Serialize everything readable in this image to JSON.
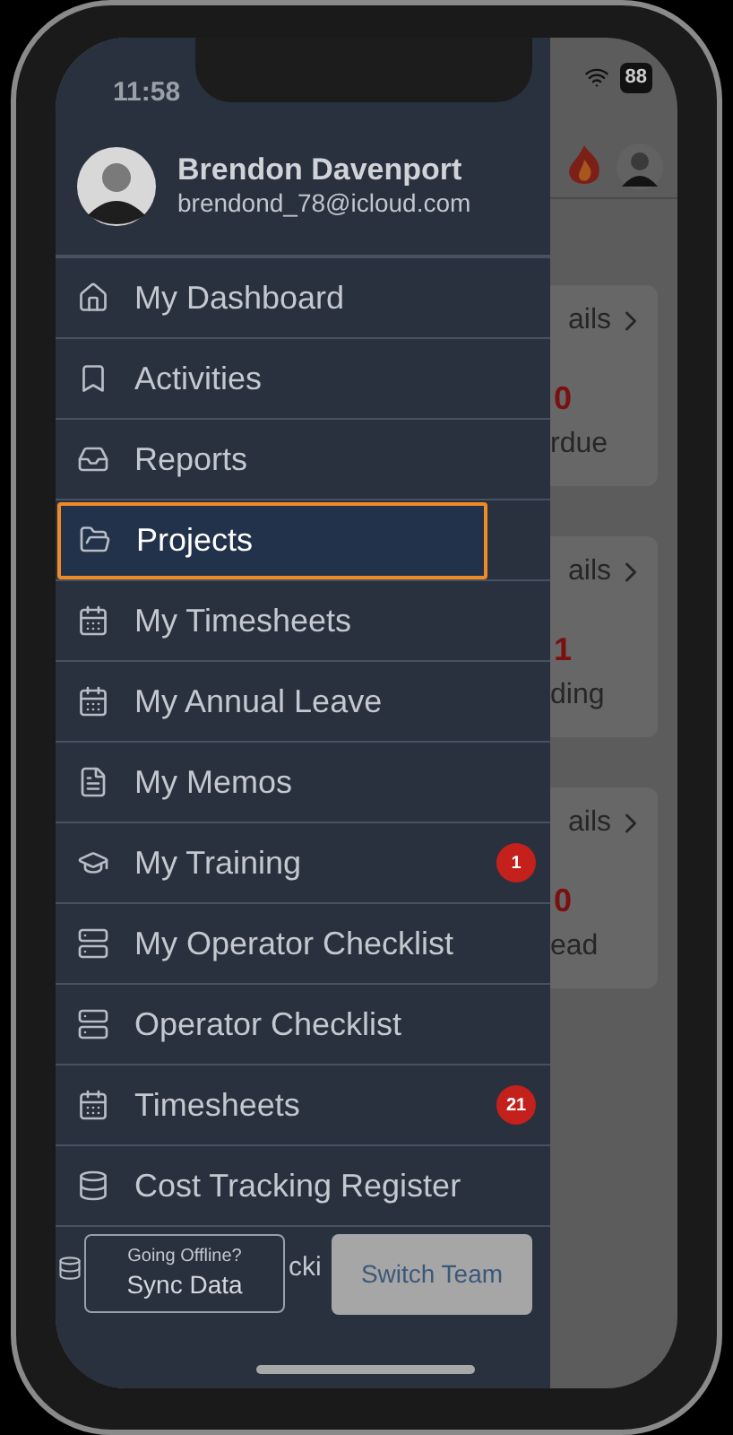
{
  "status_bar": {
    "time": "11:58",
    "battery": "88"
  },
  "profile": {
    "name": "Brendon Davenport",
    "email": "brendond_78@icloud.com"
  },
  "menu": [
    {
      "label": "My Dashboard",
      "kind": "home",
      "selected": false
    },
    {
      "label": "Activities",
      "kind": "bookmark",
      "selected": false
    },
    {
      "label": "Reports",
      "kind": "tray",
      "selected": false
    },
    {
      "label": "Projects",
      "kind": "folder",
      "selected": true
    },
    {
      "label": "My Timesheets",
      "kind": "calendar",
      "selected": false
    },
    {
      "label": "My Annual Leave",
      "kind": "calendar",
      "selected": false
    },
    {
      "label": "My Memos",
      "kind": "file",
      "selected": false
    },
    {
      "label": "My Training",
      "kind": "cap",
      "selected": false,
      "badge": "1"
    },
    {
      "label": "My Operator Checklist",
      "kind": "server",
      "selected": false
    },
    {
      "label": "Operator Checklist",
      "kind": "server",
      "selected": false
    },
    {
      "label": "Timesheets",
      "kind": "calendar",
      "selected": false,
      "badge": "21"
    },
    {
      "label": "Cost Tracking Register",
      "kind": "database",
      "selected": false
    }
  ],
  "covered_item": {
    "label": "cki",
    "kind": "database"
  },
  "sync_button": {
    "hint": "Going Offline?",
    "label": "Sync Data"
  },
  "switch_button": {
    "label": "Switch Team"
  },
  "background_cards": [
    {
      "link": "ails",
      "count": "0",
      "caption": "rdue"
    },
    {
      "link": "ails",
      "count": "1",
      "caption": "ding"
    },
    {
      "link": "ails",
      "count": "0",
      "caption": "ead"
    }
  ]
}
